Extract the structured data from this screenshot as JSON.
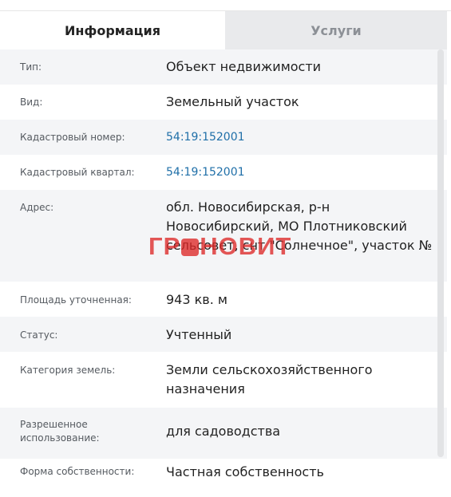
{
  "tabs": {
    "info": "Информация",
    "services": "Услуги"
  },
  "rows": [
    {
      "label": "Тип:",
      "value": "Объект недвижимости"
    },
    {
      "label": "Вид:",
      "value": "Земельный участок"
    },
    {
      "label": "Кадастровый номер:",
      "value": "54:19:152001"
    },
    {
      "label": "Кадастровый квартал:",
      "value": "54:19:152001"
    },
    {
      "label": "Адрес:",
      "value": "обл. Новосибирская, р-н Новосибирский, МО Плотниковский сельсовет, снт \"Солнечное\", участок №"
    },
    {
      "label": "Площадь уточненная:",
      "value": "943 кв. м"
    },
    {
      "label": "Статус:",
      "value": "Учтенный"
    },
    {
      "label": "Категория земель:",
      "value": "Земли сельскохозяйственного назначения"
    },
    {
      "label": "Разрешенное использование:",
      "value": "для садоводства"
    },
    {
      "label": "Форма собственности:",
      "value": "Частная собственность"
    }
  ],
  "watermark": {
    "left": "ГР",
    "right": "НОВИТ"
  },
  "colors": {
    "link": "#1f6fa8",
    "row_alt": "#f4f5f7",
    "tab_inactive_bg": "#e9eaec",
    "watermark": "#dc2828"
  }
}
